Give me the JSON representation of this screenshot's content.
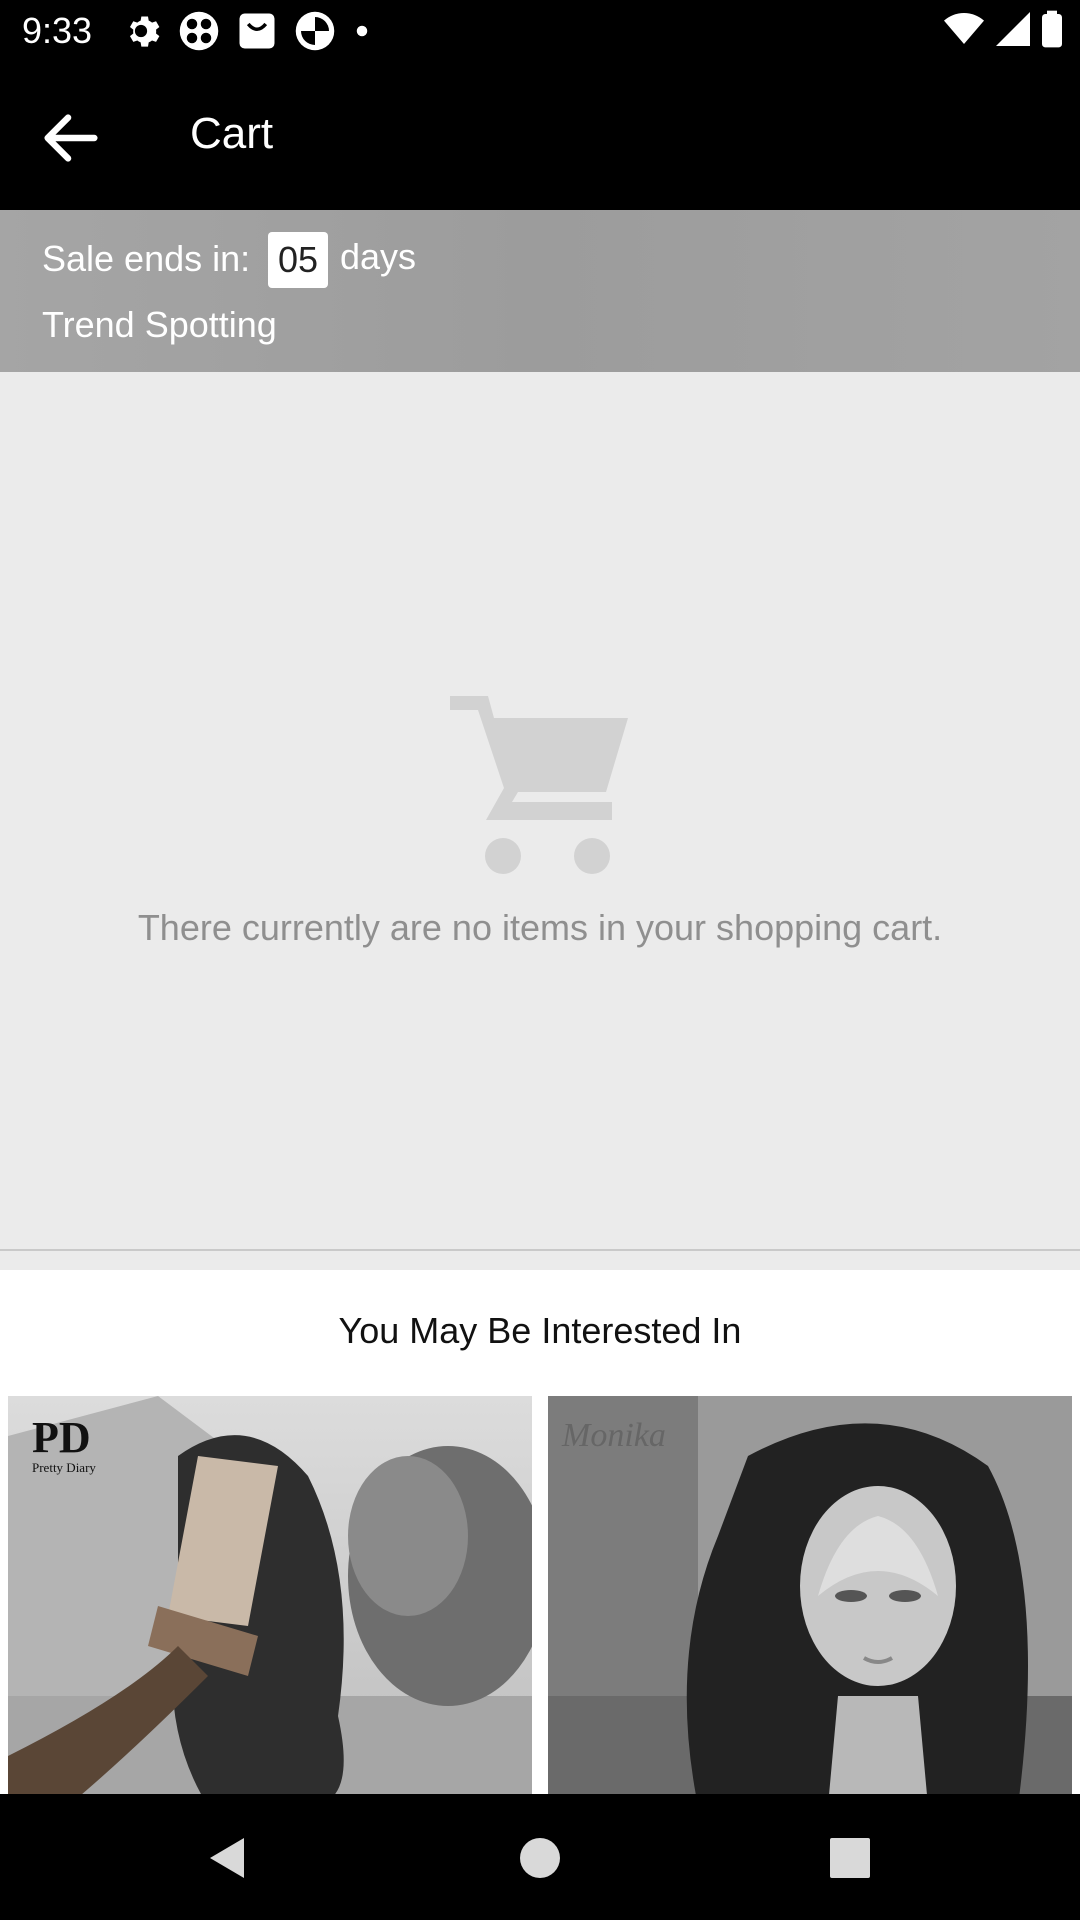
{
  "status_bar": {
    "time": "9:33",
    "left_icons": [
      "settings-icon",
      "app-icon",
      "shopping-bag-icon",
      "browser-icon",
      "notification-dot-icon"
    ],
    "right_icons": [
      "wifi-icon",
      "signal-icon",
      "battery-icon"
    ]
  },
  "app_bar": {
    "title": "Cart",
    "back_icon": "arrow-left-icon"
  },
  "sale_banner": {
    "label": "Sale ends in:",
    "countdown_value": "05",
    "countdown_unit": "days",
    "subtitle": "Trend Spotting"
  },
  "empty_cart": {
    "icon": "shopping-cart-icon",
    "message": "There currently are no items in your shopping cart."
  },
  "recommendations": {
    "title": "You May Be Interested In",
    "products": [
      {
        "brand_logo": "PD",
        "brand_name": "Pretty Diary",
        "image": "curly-lace-wig-on-hand"
      },
      {
        "brand_logo": "Monika",
        "image": "curly-wig-on-mannequin"
      }
    ]
  },
  "nav_bar": {
    "buttons": [
      "back-nav-icon",
      "home-nav-icon",
      "recents-nav-icon"
    ]
  },
  "colors": {
    "app_bar_bg": "#000000",
    "banner_bg": "#a0a0a0",
    "empty_bg": "#ebebeb",
    "muted_text": "#8f8f8f"
  }
}
